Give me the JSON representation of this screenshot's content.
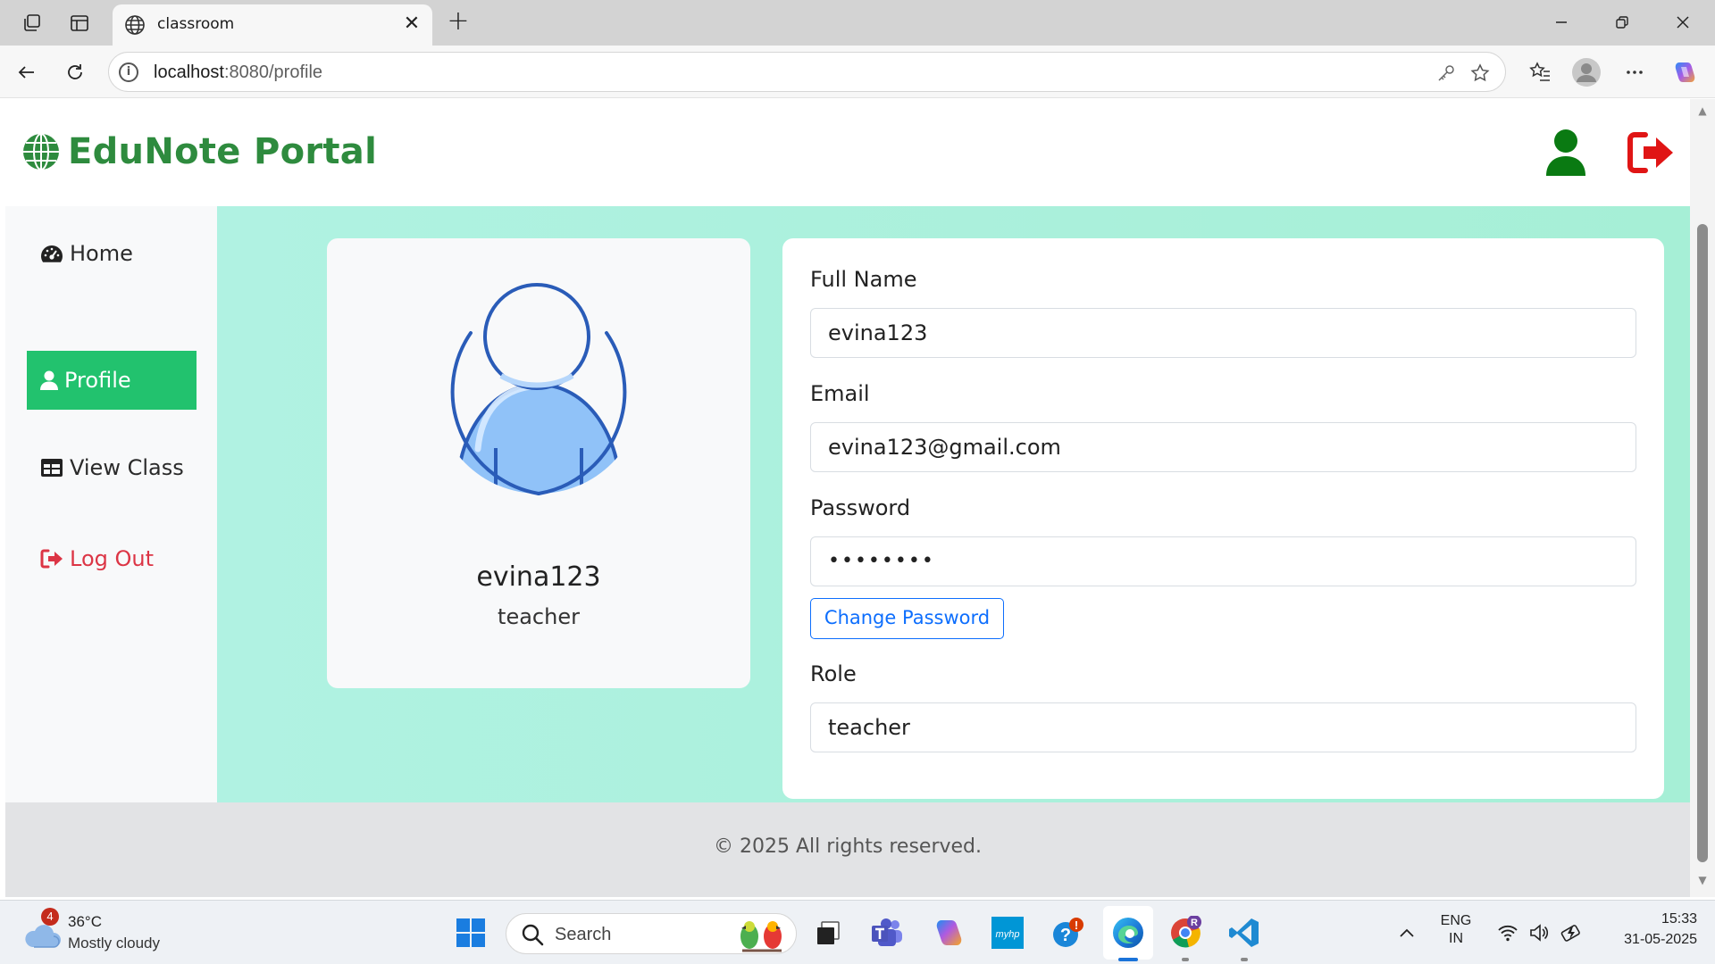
{
  "browser": {
    "tab_title": "classroom",
    "url_host": "localhost",
    "url_rest": ":8080/profile"
  },
  "header": {
    "brand": "EduNote Portal",
    "brand_color": "#2e8b3e"
  },
  "sidebar": {
    "items": [
      {
        "label": "Home",
        "icon": "dashboard-icon"
      },
      {
        "label": "Profile",
        "icon": "user-icon",
        "active": true
      },
      {
        "label": "View Class",
        "icon": "table-icon"
      },
      {
        "label": "Log Out",
        "icon": "sign-out-icon"
      }
    ],
    "active_color": "#22c26e",
    "logout_color": "#dc3545"
  },
  "profile_card": {
    "name": "evina123",
    "role": "teacher"
  },
  "form": {
    "full_name_label": "Full Name",
    "full_name_value": "evina123",
    "email_label": "Email",
    "email_value": "evina123@gmail.com",
    "password_label": "Password",
    "password_value": "••••••••",
    "change_password_label": "Change Password",
    "role_label": "Role",
    "role_value": "teacher"
  },
  "footer": {
    "text": "© 2025 All rights reserved."
  },
  "taskbar": {
    "weather_badge": "4",
    "weather_temp": "36°C",
    "weather_desc": "Mostly cloudy",
    "search_label": "Search",
    "lang_1": "ENG",
    "lang_2": "IN",
    "time": "15:33",
    "date": "31-05-2025",
    "copilot_badge": "!",
    "chrome_badge": "R"
  }
}
